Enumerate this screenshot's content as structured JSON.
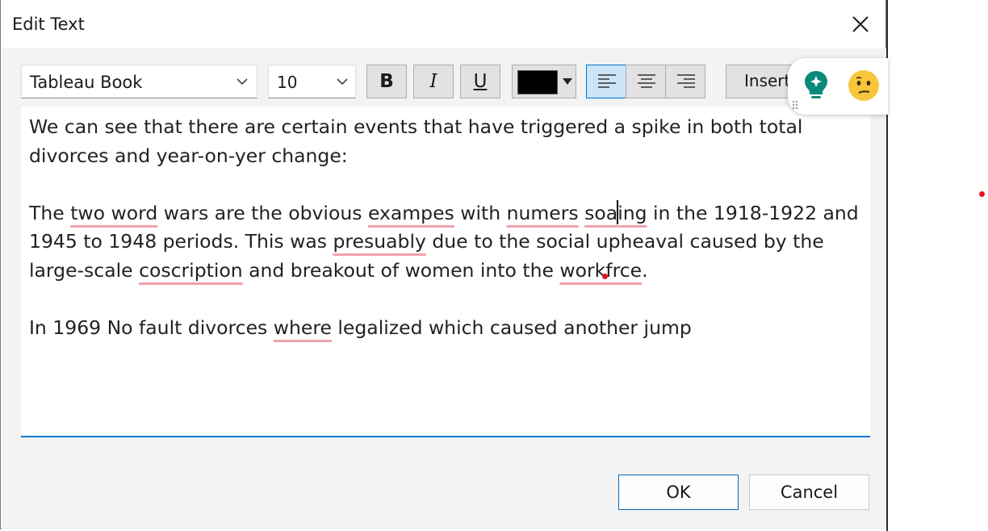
{
  "window": {
    "title": "Edit Text"
  },
  "toolbar": {
    "font_family": "Tableau Book",
    "font_size": "10",
    "bold_label": "B",
    "italic_label": "I",
    "underline_label": "U",
    "text_color": "#000000",
    "insert_label": "Insert",
    "active_alignment": "left"
  },
  "editor": {
    "paragraphs": [
      "We can see that there are certain events that have triggered a spike in both total divorces and year-on-yer change:",
      "",
      "The two word wars are the obvious exampes with numers soaing in the 1918-1922 and 1945 to 1948 periods. This was presuably due to the social upheaval caused by the large-scale coscription and breakout of women into the workfrce.",
      "",
      "In 1969 No fault divorces where legalized which caused another jump"
    ],
    "misspelled_words": [
      "two word",
      "exampes",
      "numers",
      "soaing",
      "presuably",
      "coscription",
      "workfrce",
      "where"
    ]
  },
  "buttons": {
    "ok_label": "OK",
    "cancel_label": "Cancel"
  },
  "overlay": {
    "icons": [
      "lightbulb-icon",
      "confused-face-icon"
    ]
  },
  "colors": {
    "accent": "#0078d4",
    "spellcheck_underline": "#f0a3ae",
    "marker_dot": "#e0142a"
  }
}
